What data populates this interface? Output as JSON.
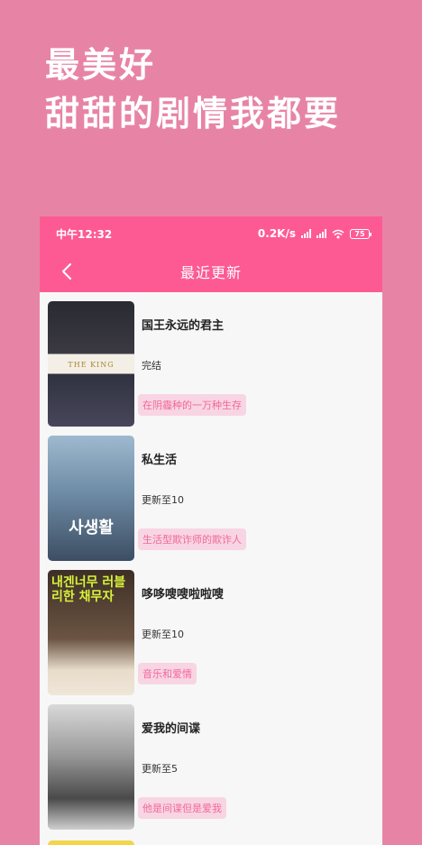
{
  "hero": {
    "line1": "最美好",
    "line2": "甜甜的剧情我都要"
  },
  "statusbar": {
    "time": "中午12:32",
    "speed": "0.2K/s",
    "battery": "75"
  },
  "navbar": {
    "title": "最近更新"
  },
  "items": [
    {
      "title": "国王永远的君主",
      "status": "完结",
      "tag": "在阴霾种的一万种生存",
      "poster_text": "THE KING"
    },
    {
      "title": "私生活",
      "status": "更新至10",
      "tag": "生活型欺诈师的欺诈人",
      "poster_text": "사생활"
    },
    {
      "title": "哆哆嗖嗖啦啦嗖",
      "status": "更新至10",
      "tag": "音乐和爱情",
      "poster_text": "내겐너무 러블리한 채무자"
    },
    {
      "title": "爱我的间谍",
      "status": "更新至5",
      "tag": "他是间谍但是爱我",
      "poster_text": ""
    }
  ],
  "colors": {
    "background": "#e784a6",
    "accent": "#fd5a93",
    "tag_bg": "#f8d5e3",
    "tag_text": "#f2679b"
  }
}
